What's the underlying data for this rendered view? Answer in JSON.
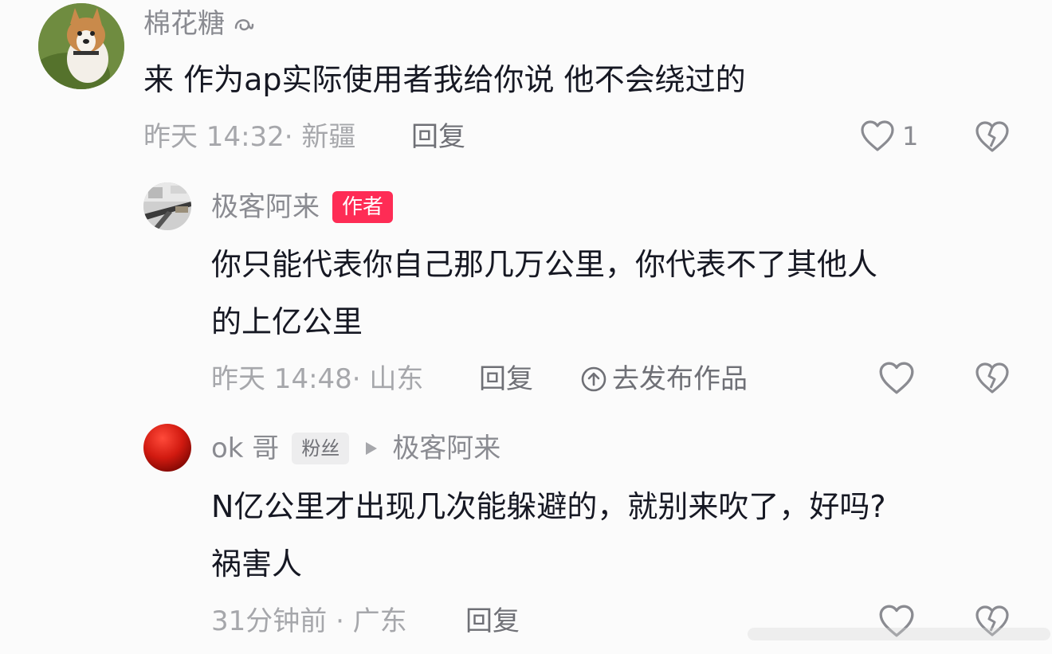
{
  "comments": [
    {
      "username": "棉花糖",
      "username_suffix_icon": "swirl-icon",
      "text": "来 作为ap实际使用者我给你说 他不会绕过的",
      "time_location": "昨天 14:32· 新疆",
      "reply_label": "回复",
      "like_count": "1",
      "avatar": "puppy-photo"
    },
    {
      "username": "极客阿来",
      "badge": "作者",
      "text_line1": "你只能代表你自己那几万公里，你代表不了其他人",
      "text_line2": "的上亿公里",
      "time_location": "昨天 14:48· 山东",
      "reply_label": "回复",
      "publish_label": "去发布作品",
      "avatar": "photo-avatar"
    },
    {
      "username": "ok 哥",
      "badge": "粉丝",
      "reply_target": "极客阿来",
      "text_line1": "N亿公里才出现几次能躲避的，就别来吹了，好吗?",
      "text_line2": "祸害人",
      "time_location": "31分钟前 · 广东",
      "reply_label": "回复",
      "avatar": "red-circle-avatar"
    }
  ],
  "colors": {
    "author_badge": "#fe2c55",
    "meta_text": "#a6a7ab",
    "body_text": "#161823"
  }
}
